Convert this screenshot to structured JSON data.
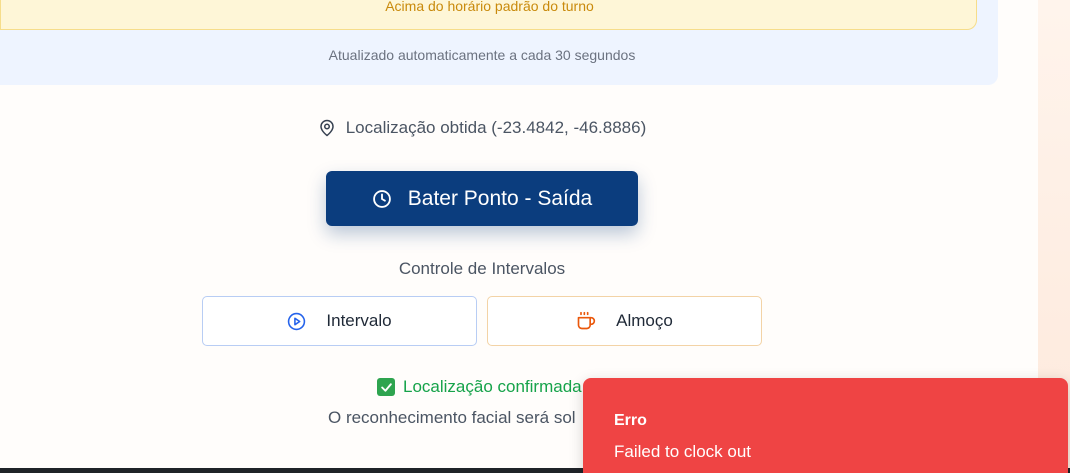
{
  "status": {
    "warning_text": "Acima do horário padrão do turno",
    "auto_update_text": "Atualizado automaticamente a cada 30 segundos"
  },
  "location": {
    "icon": "map-pin-icon",
    "text": "Localização obtida (-23.4842, -46.8886)"
  },
  "punch_button": {
    "icon": "clock-icon",
    "label": "Bater Ponto - Saída",
    "color": "#0b3d7e"
  },
  "intervals": {
    "title": "Controle de Intervalos",
    "buttons": [
      {
        "icon": "play-circle-icon",
        "label": "Intervalo",
        "icon_color": "#2563eb"
      },
      {
        "icon": "coffee-cup-icon",
        "label": "Almoço",
        "icon_color": "#ea580c"
      }
    ]
  },
  "confirmation": {
    "icon": "check-box-icon",
    "text": "Localização confirmada",
    "color": "#16a34a"
  },
  "facial_text": "O reconhecimento facial será sol",
  "toast": {
    "title": "Erro",
    "message": "Failed to clock out",
    "color": "#ef4444"
  }
}
